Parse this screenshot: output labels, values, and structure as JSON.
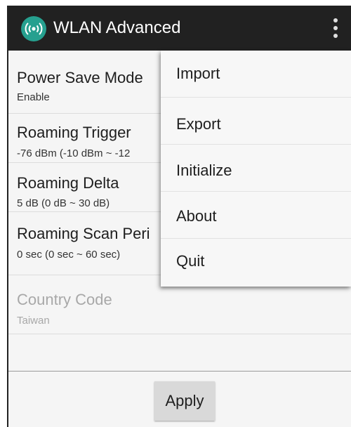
{
  "appbar": {
    "title": "WLAN Advanced",
    "app_icon": "wifi-broadcast-icon",
    "overflow_icon": "more-vertical-icon",
    "bg_color": "#212121",
    "icon_color": "#26a08f"
  },
  "preferences": [
    {
      "title": "Power Save Mode",
      "summary": "Enable",
      "enabled": true
    },
    {
      "title": "Roaming Trigger",
      "summary": "-76 dBm  (-10 dBm ~ -12",
      "enabled": true
    },
    {
      "title": "Roaming Delta",
      "summary": "5 dB  (0 dB ~ 30 dB)",
      "enabled": true
    },
    {
      "title": "Roaming Scan Peri",
      "summary": "0 sec (0 sec ~ 60 sec)",
      "enabled": true
    },
    {
      "title": "Country Code",
      "summary": "Taiwan",
      "enabled": false
    }
  ],
  "apply_label": "Apply",
  "menu": {
    "items": [
      {
        "label": "Import"
      },
      {
        "label": "Export"
      },
      {
        "label": "Initialize"
      },
      {
        "label": "About"
      },
      {
        "label": "Quit"
      }
    ]
  }
}
